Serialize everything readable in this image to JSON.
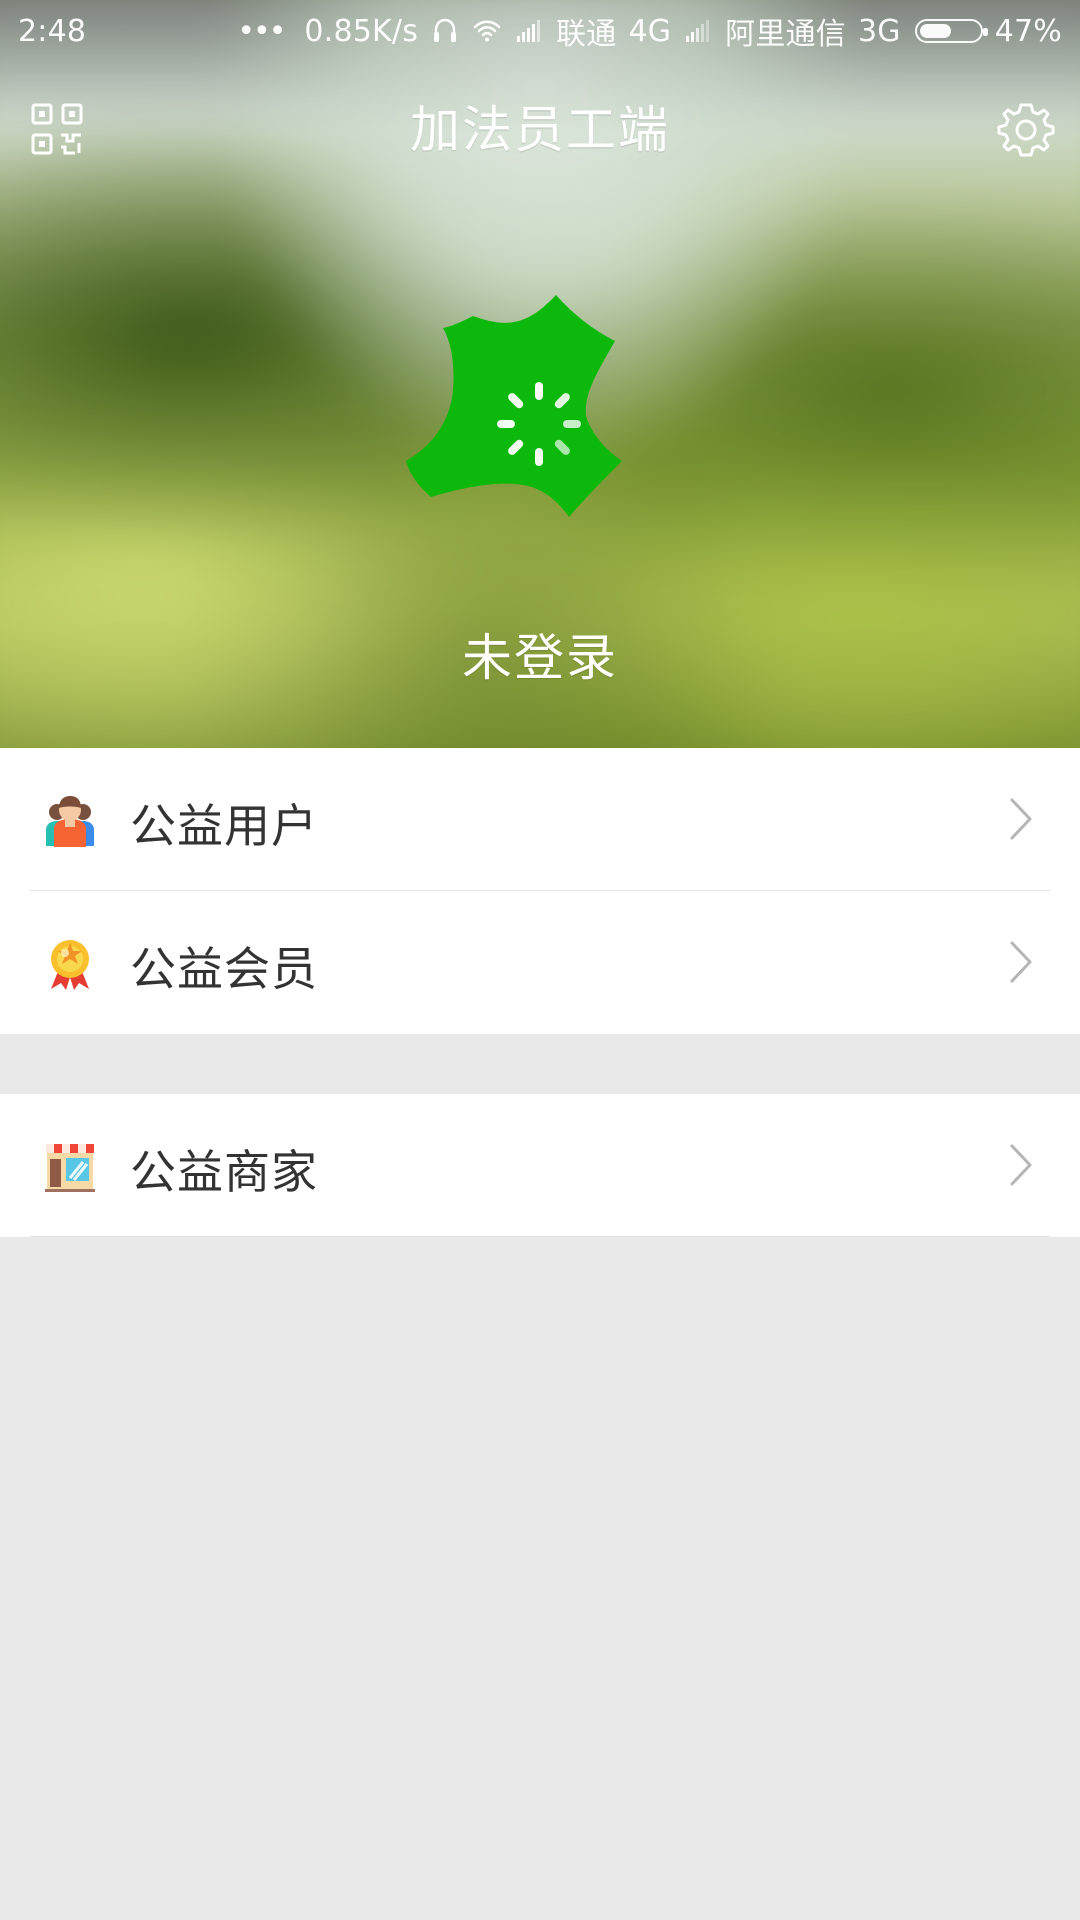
{
  "status_bar": {
    "time": "2:48",
    "more": "•••",
    "speed": "0.85K/s",
    "carrier_1": "联通",
    "network_1": "4G",
    "carrier_2": "阿里通信",
    "network_2": "3G",
    "battery": "47%",
    "icons": {
      "headphones": "headphones-icon",
      "wifi": "wifi-icon",
      "signal_1": "signal-icon",
      "signal_2": "signal-icon",
      "battery": "battery-icon"
    }
  },
  "header": {
    "title": "加法员工端",
    "left_icon": "qr-code-icon",
    "right_icon": "gear-icon",
    "colors": {
      "title": "#ffffff"
    }
  },
  "profile": {
    "status": "未登录",
    "avatar_icon": "app-logo-icon",
    "loading_icon": "spinner-icon",
    "colors": {
      "logo": "#0db80d"
    }
  },
  "menu": {
    "group_1": [
      {
        "label": "公益用户",
        "icon": "users-icon"
      },
      {
        "label": "公益会员",
        "icon": "medal-icon"
      }
    ],
    "group_2": [
      {
        "label": "公益商家",
        "icon": "store-icon"
      }
    ],
    "chevron_icon": "chevron-right-icon"
  },
  "colors": {
    "page_background": "#e9e9e9",
    "card_background": "#ffffff",
    "divider": "#e2e2e2",
    "text_primary": "#333333",
    "chevron": "#b5b5b5"
  }
}
